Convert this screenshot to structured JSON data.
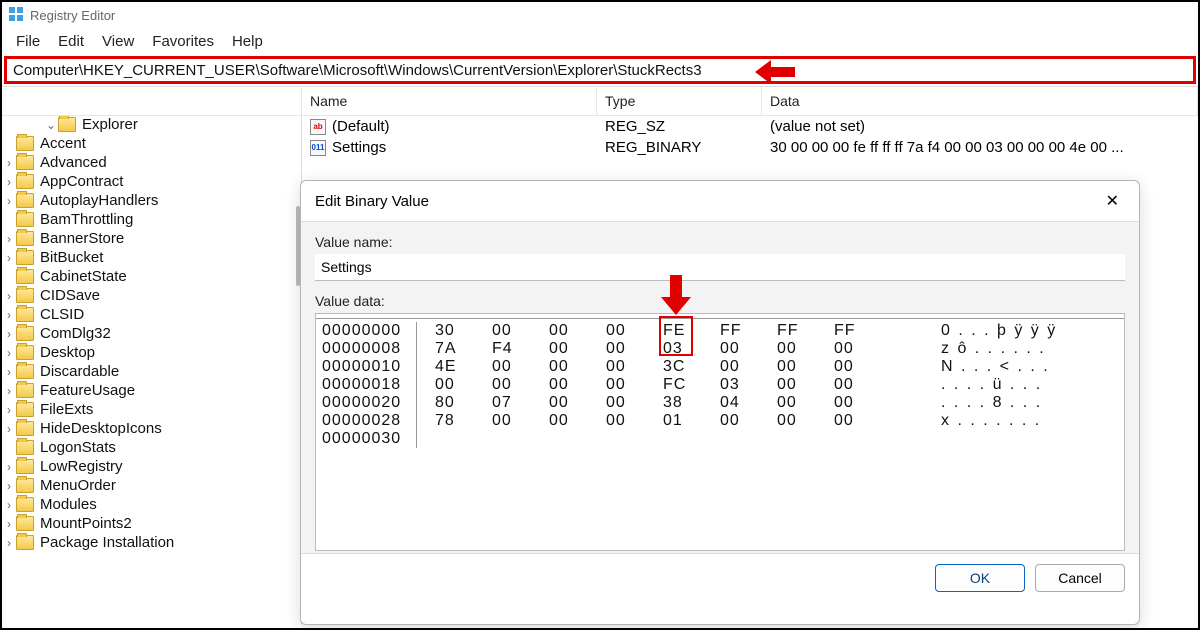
{
  "title": "Registry Editor",
  "menu": [
    "File",
    "Edit",
    "View",
    "Favorites",
    "Help"
  ],
  "address": "Computer\\HKEY_CURRENT_USER\\Software\\Microsoft\\Windows\\CurrentVersion\\Explorer\\StuckRects3",
  "columns": {
    "name": "Name",
    "type": "Type",
    "data": "Data"
  },
  "tree": {
    "root": "Explorer",
    "items": [
      "Accent",
      "Advanced",
      "AppContract",
      "AutoplayHandlers",
      "BamThrottling",
      "BannerStore",
      "BitBucket",
      "CabinetState",
      "CIDSave",
      "CLSID",
      "ComDlg32",
      "Desktop",
      "Discardable",
      "FeatureUsage",
      "FileExts",
      "HideDesktopIcons",
      "LogonStats",
      "LowRegistry",
      "MenuOrder",
      "Modules",
      "MountPoints2",
      "Package Installation"
    ],
    "expandable": [
      false,
      true,
      true,
      true,
      false,
      true,
      true,
      false,
      true,
      true,
      true,
      true,
      true,
      true,
      true,
      true,
      false,
      true,
      true,
      true,
      true,
      true
    ]
  },
  "values": [
    {
      "name": "(Default)",
      "type": "REG_SZ",
      "data": "(value not set)",
      "icon": "sz"
    },
    {
      "name": "Settings",
      "type": "REG_BINARY",
      "data": "30 00 00 00 fe ff ff ff 7a f4 00 00 03 00 00 00 4e 00 ...",
      "icon": "bin"
    }
  ],
  "dialog": {
    "title": "Edit Binary Value",
    "name_label": "Value name:",
    "name_value": "Settings",
    "data_label": "Value data:",
    "ok": "OK",
    "cancel": "Cancel",
    "hex": [
      {
        "off": "00000000",
        "b": [
          "30",
          "00",
          "00",
          "00",
          "FE",
          "FF",
          "FF",
          "FF"
        ],
        "a": "0 . . . þ ÿ ÿ ÿ"
      },
      {
        "off": "00000008",
        "b": [
          "7A",
          "F4",
          "00",
          "00",
          "03",
          "00",
          "00",
          "00"
        ],
        "a": "z ô . . . . . ."
      },
      {
        "off": "00000010",
        "b": [
          "4E",
          "00",
          "00",
          "00",
          "3C",
          "00",
          "00",
          "00"
        ],
        "a": "N . . . < . . ."
      },
      {
        "off": "00000018",
        "b": [
          "00",
          "00",
          "00",
          "00",
          "FC",
          "03",
          "00",
          "00"
        ],
        "a": ". . . . ü . . ."
      },
      {
        "off": "00000020",
        "b": [
          "80",
          "07",
          "00",
          "00",
          "38",
          "04",
          "00",
          "00"
        ],
        "a": ". . . . 8 . . ."
      },
      {
        "off": "00000028",
        "b": [
          "78",
          "00",
          "00",
          "00",
          "01",
          "00",
          "00",
          "00"
        ],
        "a": "x . . . . . . ."
      },
      {
        "off": "00000030",
        "b": [
          "",
          "",
          "",
          "",
          "",
          "",
          "",
          ""
        ],
        "a": ""
      }
    ]
  }
}
